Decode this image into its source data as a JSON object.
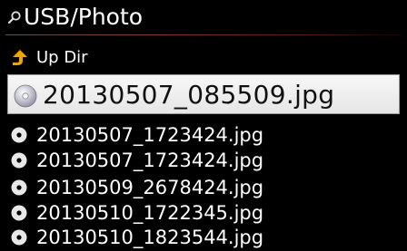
{
  "header": {
    "title": "USB/Photo",
    "icon": "search-icon"
  },
  "up_dir": {
    "label": "Up Dir",
    "icon": "up-arrow-icon",
    "icon_color": "#f2a400"
  },
  "selected_file": {
    "name": "20130507_085509.jpg",
    "icon": "disc-icon"
  },
  "files": [
    {
      "name": "20130507_1723424.jpg",
      "icon": "disc-icon"
    },
    {
      "name": "20130507_1723424.jpg",
      "icon": "disc-icon"
    },
    {
      "name": "20130509_2678424.jpg",
      "icon": "disc-icon"
    },
    {
      "name": "20130510_1722345.jpg",
      "icon": "disc-icon"
    },
    {
      "name": "20130510_1823544.jpg",
      "icon": "disc-icon"
    }
  ],
  "colors": {
    "background": "#000000",
    "accent_rule": "#c41a1a",
    "selection": "#eeeeee"
  }
}
